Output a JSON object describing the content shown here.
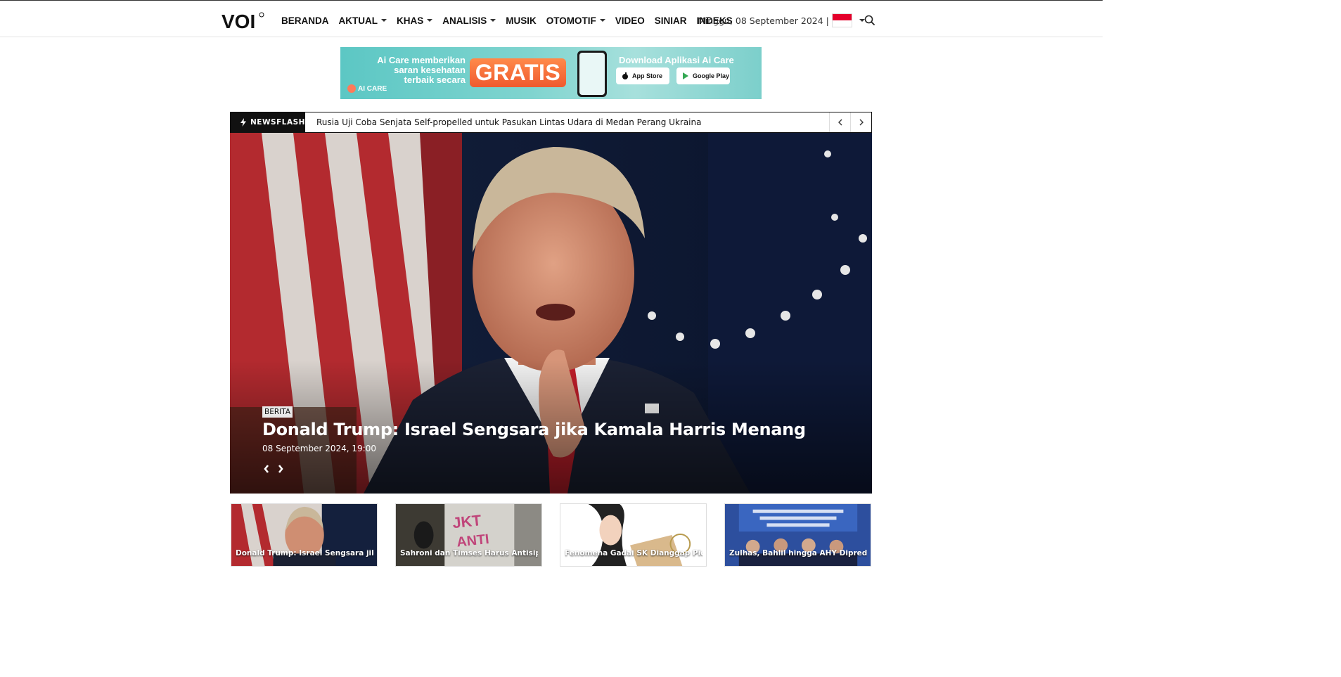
{
  "header": {
    "logo_text": "VOI",
    "nav": [
      {
        "label": "BERANDA",
        "dropdown": false
      },
      {
        "label": "AKTUAL",
        "dropdown": true
      },
      {
        "label": "KHAS",
        "dropdown": true
      },
      {
        "label": "ANALISIS",
        "dropdown": true
      },
      {
        "label": "MUSIK",
        "dropdown": false
      },
      {
        "label": "OTOMOTIF",
        "dropdown": true
      },
      {
        "label": "VIDEO",
        "dropdown": false
      },
      {
        "label": "SINIAR",
        "dropdown": false
      },
      {
        "label": "INDEKS",
        "dropdown": false
      }
    ],
    "date": "Minggu, 08 September 2024 |",
    "language_flag": "indonesia-flag-icon",
    "search_icon": "search-icon"
  },
  "ad": {
    "headline": "Ai Care memberikan saran kesehatan terbaik secara",
    "highlight": "GRATIS",
    "download": "Download Aplikasi Ai Care",
    "app_store": "App Store",
    "google_play": "Google Play",
    "brand": "AI CARE"
  },
  "newsflash": {
    "label": "NEWSFLASH",
    "text": "Rusia Uji Coba Senjata Self-propelled untuk Pasukan Lintas Udara di Medan Perang Ukraina"
  },
  "hero": {
    "category": "BERITA",
    "title": "Donald Trump: Israel Sengsara jika Kamala Harris Menang",
    "date": "08 September 2024, 19:00"
  },
  "cards": [
    {
      "caption": "Donald Trump: Israel Sengsara jika"
    },
    {
      "caption": "Sahroni dan Timses Harus Antisipasi"
    },
    {
      "caption": "Fenomena Gadai SK Dianggap Picu"
    },
    {
      "caption": "Zulhas, Bahlil hingga AHY Diprediksi"
    }
  ],
  "colors": {
    "accent_dark": "#111111",
    "ad_teal": "#5cc7c4",
    "ad_orange": "#ef5a2f"
  }
}
